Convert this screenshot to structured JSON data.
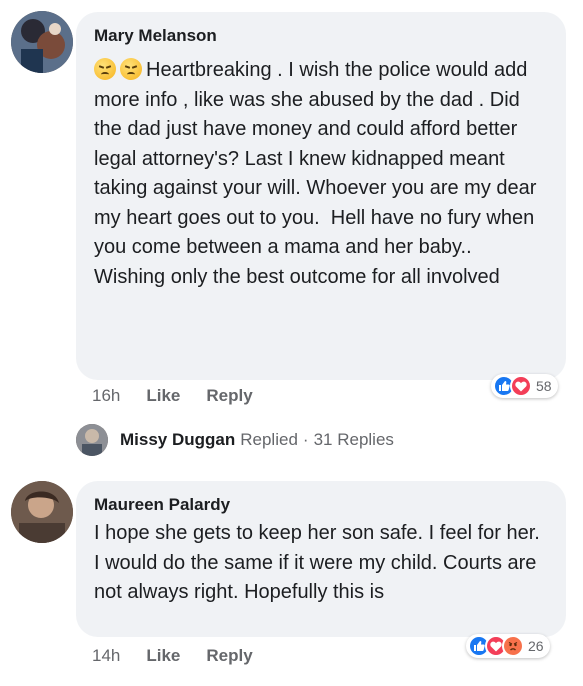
{
  "comments": [
    {
      "author": "Mary Melanson",
      "emoji_names": [
        "persevering-face-emoji",
        "persevering-face-emoji"
      ],
      "text": "Heartbreaking . I wish the police would add more info , like was she abused by the dad . Did the dad just have money and could afford better legal attorney's? Last I knew kidnapped meant taking against your will. Whoever you are my dear my heart goes out to you.  Hell have no fury when you come between a mama and her baby..\nWishing only the best outcome for all involved",
      "time": "16h",
      "like_label": "Like",
      "reply_label": "Reply",
      "reactions": [
        "like",
        "love"
      ],
      "reaction_count": "58"
    },
    {
      "author": "Maureen Palardy",
      "text": "I hope she gets to keep her son safe. I feel for her. I would do the same if it were my child. Courts are not always right. Hopefully this is",
      "time": "14h",
      "like_label": "Like",
      "reply_label": "Reply",
      "reactions": [
        "like",
        "love",
        "angry"
      ],
      "reaction_count": "26"
    }
  ],
  "replies": {
    "author": "Missy Duggan",
    "replied_label": "Replied",
    "separator": "·",
    "count_label": "31 Replies"
  },
  "colors": {
    "like": "#1877f2",
    "love": "#f33e58",
    "angry": "#f7714b",
    "bubble": "#f0f2f5",
    "meta": "#65676b"
  }
}
